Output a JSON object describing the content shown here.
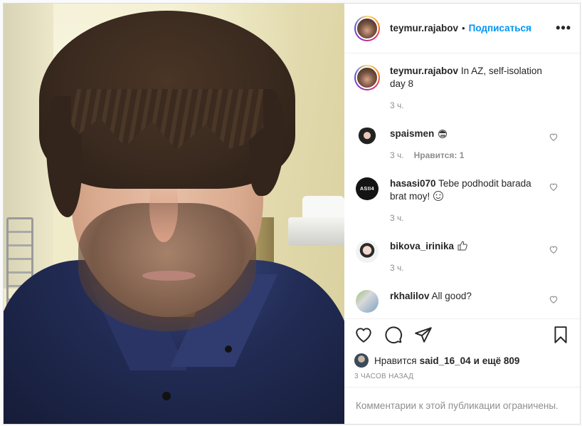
{
  "header": {
    "username": "teymur.rajabov",
    "separator": "•",
    "follow_label": "Подписаться",
    "more_icon": "more-horizontal-icon"
  },
  "caption": {
    "username": "teymur.rajabov",
    "text": "In AZ, self-isolation day 8",
    "time": "3 ч."
  },
  "comments": [
    {
      "username": "spaismen",
      "text": "",
      "emoji": "woman-facepalming-emoji",
      "time": "3 ч.",
      "likes": "Нравится: 1"
    },
    {
      "username": "hasasi070",
      "text": "Tebe podhodit barada brat moy!",
      "emoji": "smiling-face-emoji",
      "time": "3 ч.",
      "avatar_text": "ASII4"
    },
    {
      "username": "bikova_irinika",
      "text": "",
      "emoji": "thumbs-up-emoji",
      "time": "3 ч."
    },
    {
      "username": "rkhalilov",
      "text": "All good?",
      "time": ""
    }
  ],
  "actions": {
    "like_icon": "heart-icon",
    "comment_icon": "comment-icon",
    "share_icon": "paper-plane-icon",
    "save_icon": "bookmark-icon"
  },
  "likes": {
    "prefix": "Нравится",
    "user": "said_16_04",
    "suffix": "и ещё 809"
  },
  "timestamp": "3 ЧАСОВ НАЗАД",
  "comments_disabled": "Комментарии к этой публикации ограничены.",
  "colors": {
    "link": "#0095f6",
    "text": "#262626",
    "muted": "#8e8e8e",
    "border": "#efefef"
  }
}
